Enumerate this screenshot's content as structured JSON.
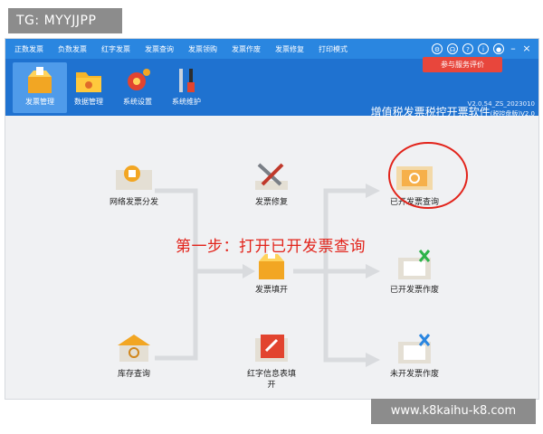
{
  "watermark_top": "TG: MYYJJPP",
  "watermark_bottom": "www.k8kaihu-k8.com",
  "menu": [
    "正数发票",
    "负数发票",
    "红字发票",
    "发票查询",
    "发票领购",
    "发票作废",
    "发票修复",
    "打印模式"
  ],
  "window_icons": [
    "settings-icon",
    "headset-icon",
    "help-icon",
    "info-icon",
    "user-icon",
    "minimize-icon",
    "close-icon"
  ],
  "feedback_button": "参与服务评价",
  "toolbar": [
    {
      "label": "发票管理",
      "active": true
    },
    {
      "label": "数据管理",
      "active": false
    },
    {
      "label": "系统设置",
      "active": false
    },
    {
      "label": "系统维护",
      "active": false
    }
  ],
  "brand": {
    "title": "增值税发票税控开票软件",
    "edition": "(税控盘版)V2.0",
    "version": "V2.0.54_ZS_2023010"
  },
  "nodes": {
    "network_dist": "网络发票分发",
    "invoice_repair": "发票修复",
    "issued_query": "已开发票查询",
    "invoice_fill": "发票填开",
    "issued_void": "已开发票作废",
    "stock_query": "库存查询",
    "red_info": "红字信息表填\n开",
    "unissued_void": "未开发票作废"
  },
  "annotation": "第一步：打开已开发票查询",
  "colors": {
    "menubar": "#2a86e0",
    "toolbar": "#1f72d0",
    "active_tool": "#4f9bea",
    "annotation": "#e2231a",
    "feedback": "#e8463c",
    "connector": "#d9dbde"
  }
}
